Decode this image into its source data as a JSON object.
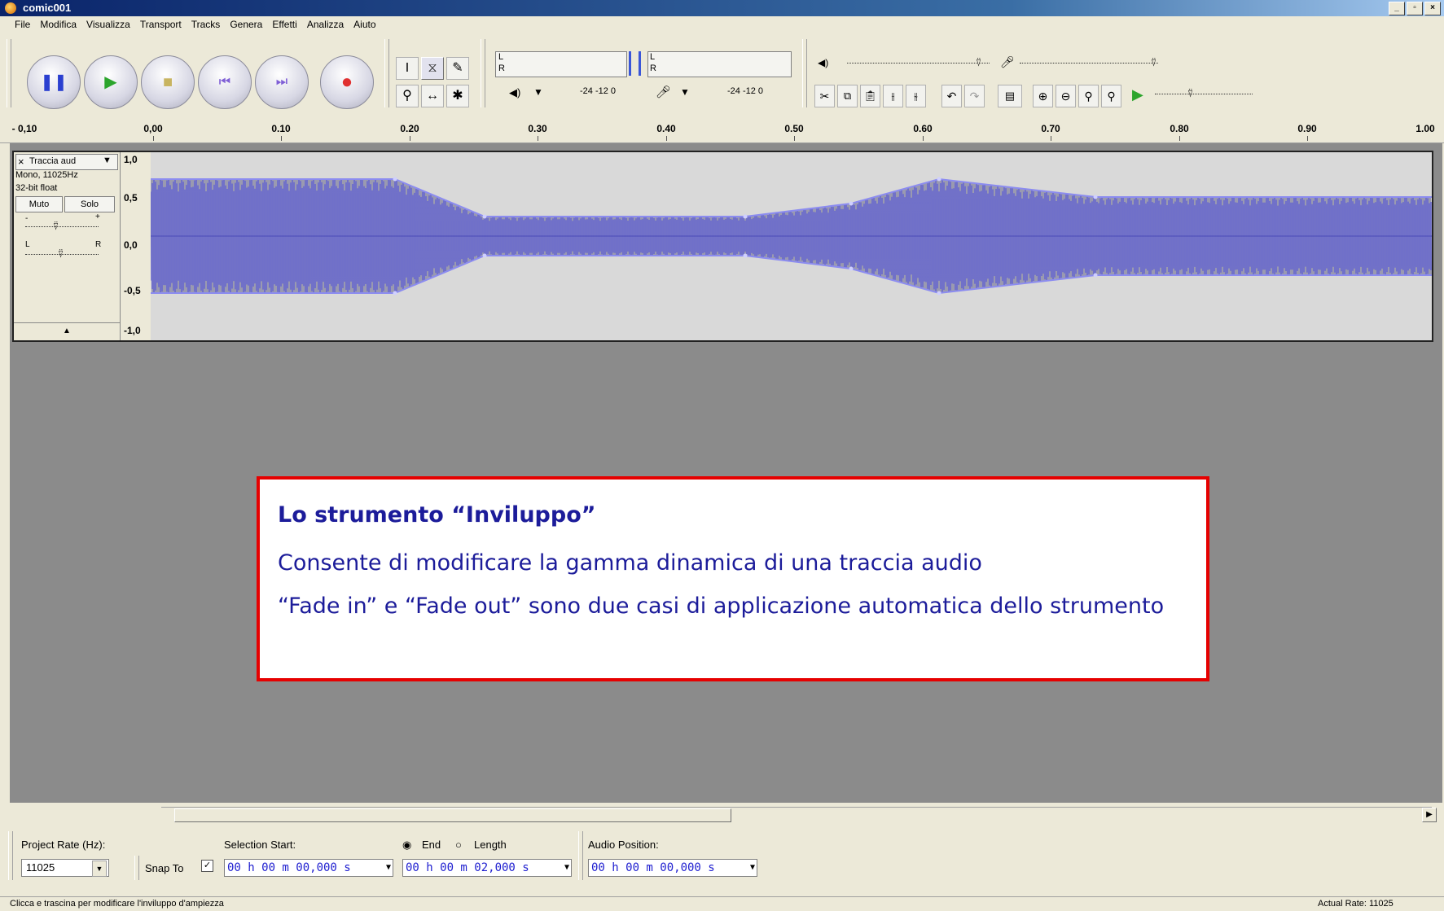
{
  "window": {
    "title": "comic001",
    "controls": [
      "_",
      "▫",
      "×"
    ]
  },
  "menu": [
    "File",
    "Modifica",
    "Visualizza",
    "Transport",
    "Tracks",
    "Genera",
    "Effetti",
    "Analizza",
    "Aiuto"
  ],
  "meters": {
    "out_l": "L",
    "out_r": "R",
    "in_l": "L",
    "in_r": "R",
    "out_scale": "-24  -12   0",
    "in_scale": "-24  -12   0"
  },
  "ruler": [
    "- 0,10",
    "0,00",
    "0.10",
    "0.20",
    "0.30",
    "0.40",
    "0.50",
    "0.60",
    "0.70",
    "0.80",
    "0.90",
    "1.00"
  ],
  "track": {
    "name": "Traccia aud",
    "info1": "Mono, 11025Hz",
    "info2": "32-bit float",
    "mute": "Muto",
    "solo": "Solo",
    "gain_minus": "-",
    "gain_plus": "+",
    "pan_l": "L",
    "pan_r": "R",
    "collapse": "▲",
    "scale": [
      "1,0",
      "0,5",
      "0,0",
      "-0,5",
      "-1,0"
    ],
    "close": "×",
    "menu_arrow": "▼"
  },
  "callout": {
    "heading": "Lo strumento “Inviluppo”",
    "p1": "Consente di modificare la gamma dinamica di una traccia audio",
    "p2": "“Fade in” e “Fade out” sono due casi di applicazione automatica dello strumento"
  },
  "selection": {
    "project_rate_label": "Project Rate (Hz):",
    "project_rate_value": "11025",
    "selection_start_label": "Selection Start:",
    "end_label": "End",
    "length_label": "Length",
    "audio_position_label": "Audio Position:",
    "snap_to_label": "Snap To",
    "start_value": "00 h 00 m 00,000 s",
    "end_value": "00 h 00 m 02,000 s",
    "position_value": "00 h 00 m 00,000 s"
  },
  "status": {
    "message": "Clicca e trascina per modificare l'inviluppo d'ampiezza",
    "rate": "Actual Rate: 11025"
  },
  "colors": {
    "waveform": "#5b5bd6",
    "envelope": "#8c8cf0",
    "callout_border": "#e60000",
    "callout_text": "#1c1c9a"
  }
}
